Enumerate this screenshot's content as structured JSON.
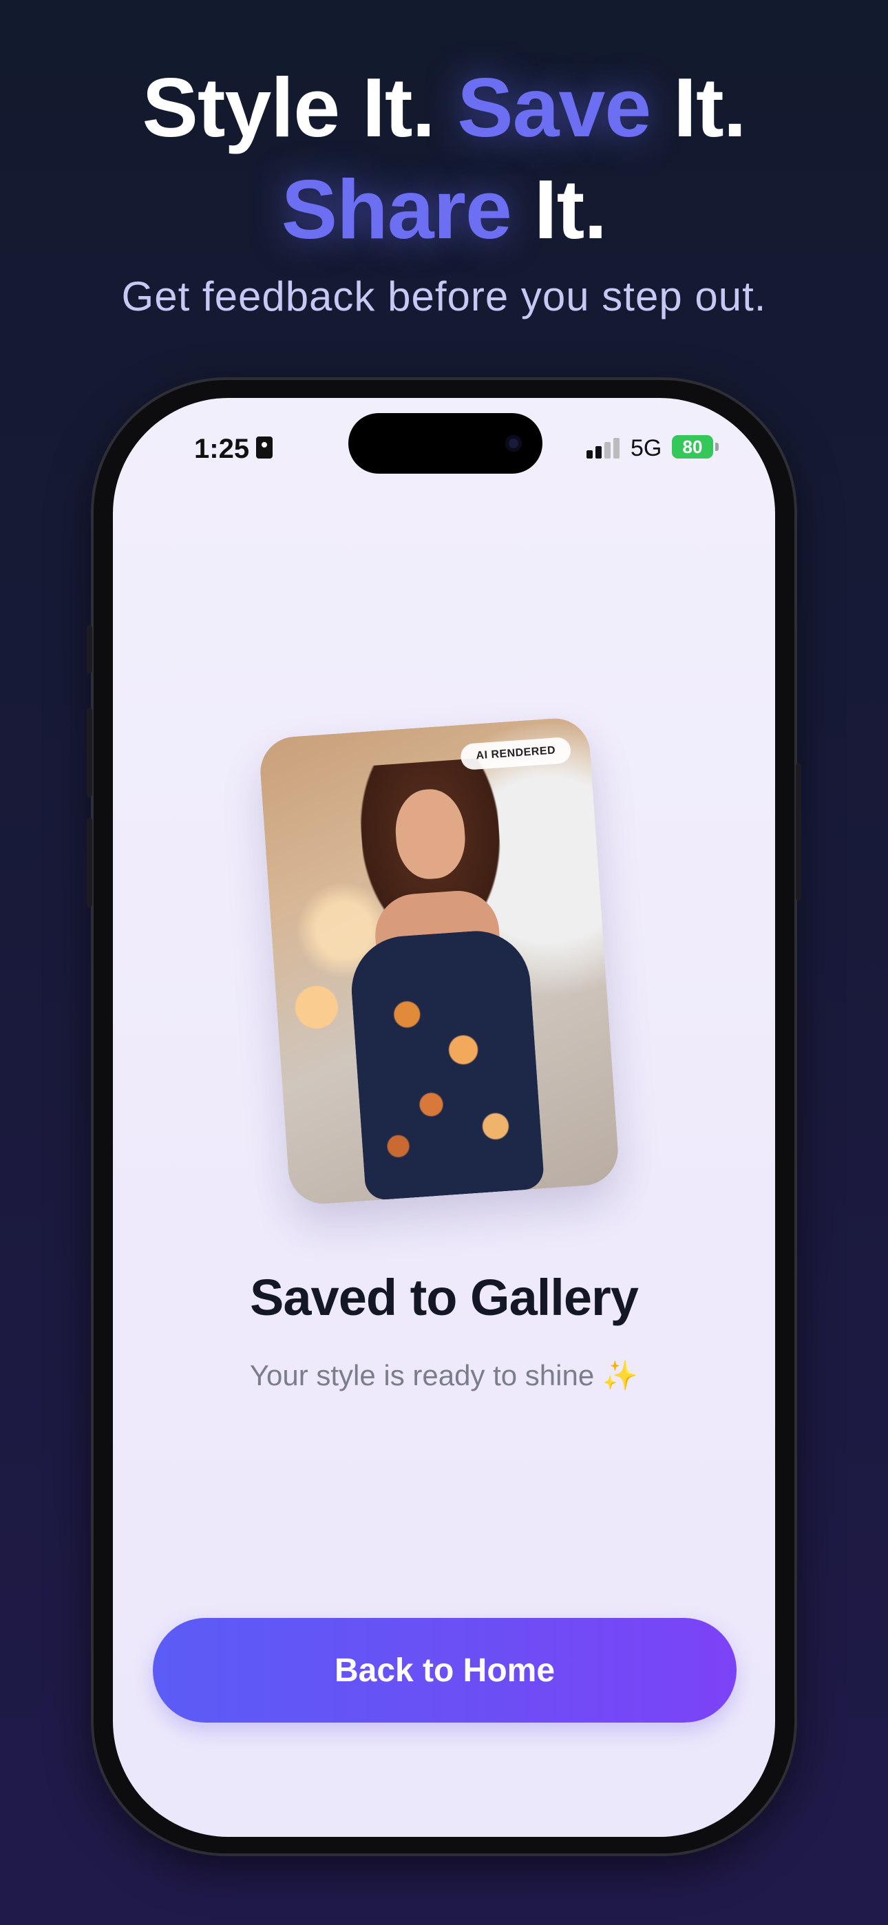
{
  "headline": {
    "line1_part1": "Style It. ",
    "line1_accent": "Save",
    "line1_part2": " It.",
    "line2_accent": "Share",
    "line2_part2": " It."
  },
  "subhead": "Get feedback before you step out.",
  "status_bar": {
    "time": "1:25",
    "network": "5G",
    "battery": "80"
  },
  "photo": {
    "badge": "AI RENDERED"
  },
  "main": {
    "title": "Saved to Gallery",
    "subtitle": "Your style is ready to shine ✨",
    "cta_label": "Back to Home"
  },
  "colors": {
    "accent": "#6d6ff2",
    "button_start": "#5b5cf6",
    "button_end": "#7c43f6",
    "battery": "#34c759"
  }
}
